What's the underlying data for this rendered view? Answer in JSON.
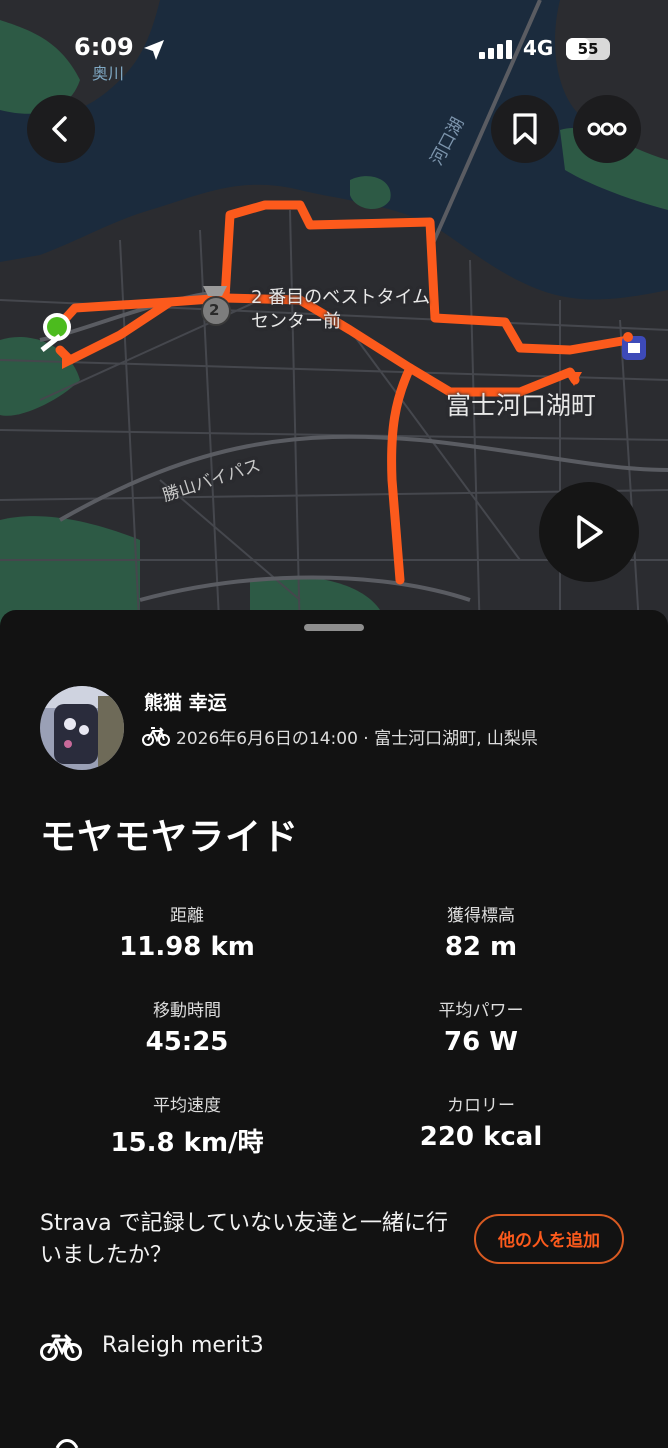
{
  "status_bar": {
    "time": "6:09",
    "network": "4G",
    "battery": "55",
    "battery_level": 0.55
  },
  "map": {
    "segment_label_line1": "2 番目のベストタイム",
    "segment_label_line2": "センター前",
    "segment_rank": "2",
    "town_label": "富士河口湖町",
    "road_label": "勝山バイパス",
    "lake_label": "河口湖",
    "river_label": "奥川",
    "colors": {
      "route": "#fc5a1c",
      "water": "#1b2b3d",
      "land": "#2b2c30",
      "park": "#2d5a45"
    }
  },
  "athlete": {
    "name": "熊猫 幸运",
    "meta": "2026年6月6日の14:00 · 富士河口湖町, 山梨県"
  },
  "activity": {
    "title": "モヤモヤライド"
  },
  "stats": [
    {
      "label": "距離",
      "value": "11.98 km"
    },
    {
      "label": "獲得標高",
      "value": "82 m"
    },
    {
      "label": "移動時間",
      "value": "45:25"
    },
    {
      "label": "平均パワー",
      "value": "76 W"
    },
    {
      "label": "平均速度",
      "value": "15.8 km/時"
    },
    {
      "label": "カロリー",
      "value": "220 kcal"
    }
  ],
  "friends": {
    "prompt": "Strava で記録していない友達と一緒に行いましたか？",
    "button": "他の人を追加"
  },
  "gear": {
    "name": "Raleigh merit3"
  },
  "icons": [
    "location-arrow-icon",
    "signal-icon",
    "back-icon",
    "bookmark-icon",
    "more-icon",
    "play-icon",
    "bike-icon",
    "medal-icon"
  ],
  "accent": "#fc5a1c"
}
